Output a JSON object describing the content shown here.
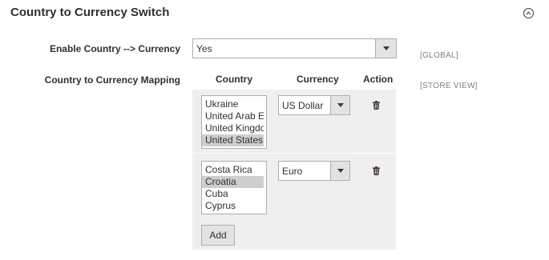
{
  "section": {
    "title": "Country to Currency Switch",
    "toggle_icon": "chevron-up-circle-icon"
  },
  "enable_field": {
    "label": "Enable Country --> Currency",
    "value": "Yes",
    "scope": "[GLOBAL]"
  },
  "mapping_field": {
    "label": "Country to Currency Mapping",
    "scope": "[STORE VIEW]",
    "columns": [
      "Country",
      "Currency",
      "Action"
    ],
    "rows": [
      {
        "countries": [
          "Ukraine",
          "United Arab Em",
          "United Kingdom",
          "United States"
        ],
        "selected_country": "United States",
        "currency": "US Dollar",
        "action_icon": "trash-icon"
      },
      {
        "countries": [
          "Costa Rica",
          "Croatia",
          "Cuba",
          "Cyprus"
        ],
        "selected_country": "Croatia",
        "currency": "Euro",
        "action_icon": "trash-icon"
      }
    ],
    "add_label": "Add"
  }
}
